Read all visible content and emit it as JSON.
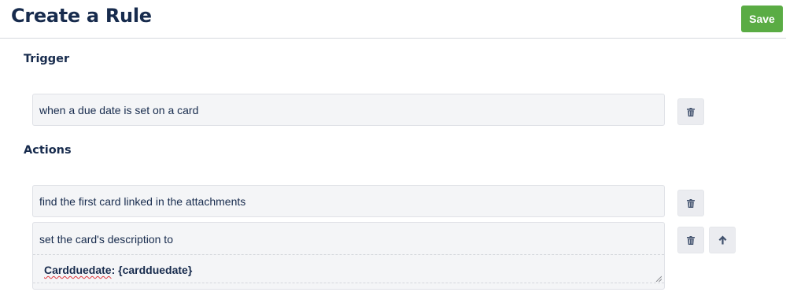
{
  "header": {
    "title": "Create a Rule",
    "save_label": "Save",
    "save_color": "#5aac44"
  },
  "trigger": {
    "title": "Trigger",
    "text": "when a due date is set on a card",
    "delete_icon": "trash-icon"
  },
  "actions": {
    "title": "Actions",
    "items": [
      {
        "text": "find the first card linked in the attachments",
        "delete_icon": "trash-icon"
      },
      {
        "text": "set the card's description to",
        "value_word": "Cardduedate",
        "value_rest": ": {cardduedate}",
        "delete_icon": "trash-icon",
        "move_icon": "arrow-up-icon"
      }
    ]
  }
}
